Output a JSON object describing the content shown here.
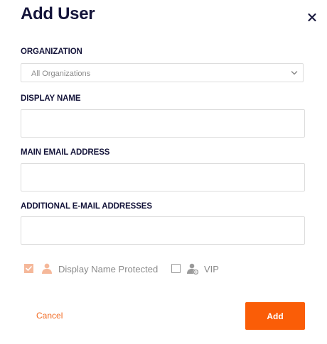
{
  "dialog": {
    "title": "Add User",
    "close_icon": "close-icon"
  },
  "fields": {
    "organization": {
      "label": "ORGANIZATION",
      "value": "All Organizations",
      "icon": "chevron-down-icon"
    },
    "display_name": {
      "label": "DISPLAY NAME",
      "value": "",
      "placeholder": ""
    },
    "main_email": {
      "label": "MAIN EMAIL ADDRESS",
      "value": "",
      "placeholder": ""
    },
    "additional_emails": {
      "label": "ADDITIONAL E-MAIL ADDRESSES",
      "value": "",
      "placeholder": ""
    }
  },
  "options": {
    "display_name_protected": {
      "label": "Display Name Protected",
      "checked": true,
      "icon": "user-protected-icon"
    },
    "vip": {
      "label": "VIP",
      "checked": false,
      "icon": "user-vip-icon"
    }
  },
  "actions": {
    "cancel_label": "Cancel",
    "add_label": "Add"
  },
  "colors": {
    "accent": "#fa5d07",
    "cancel_text": "#f26a21",
    "title_text": "#14143a",
    "checkbox_checked": "#f5b89a",
    "muted_text": "#8a8a8a"
  }
}
